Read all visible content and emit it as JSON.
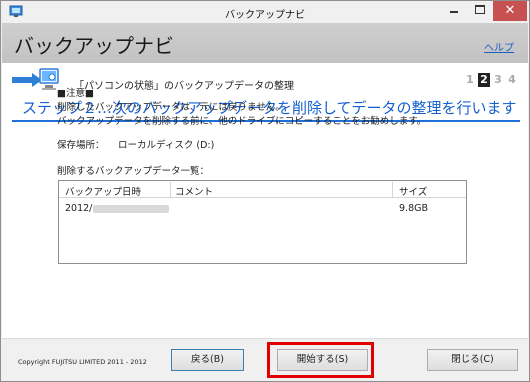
{
  "window": {
    "title": "バックアップナビ",
    "controls": {
      "minimize": "minimize",
      "maximize": "maximize",
      "close": "✕"
    }
  },
  "header": {
    "title": "バックアップナビ",
    "help_link": "ヘルプ"
  },
  "step": {
    "caption": "「パソコンの状態」のバックアップデータの整理",
    "numbers": [
      "1",
      "2",
      "3",
      "4"
    ],
    "active_index": 1,
    "heading": "ステップ２…次のバックアップデータを削除してデータの整理を行います"
  },
  "notice": {
    "title": "■注意■",
    "line1": "削除したバックアップデータは、元には戻りません。",
    "line2": "バックアップデータを削除する前に、他のドライブにコピーすることをお勧めします。"
  },
  "storage": {
    "label": "保存場所：",
    "value": "ローカルディスク (D:)"
  },
  "list": {
    "label": "削除するバックアップデータ一覧：",
    "columns": [
      "バックアップ日時",
      "コメント",
      "サイズ"
    ],
    "rows": [
      {
        "date": "2012/",
        "comment": "",
        "size": "9.8GB"
      }
    ]
  },
  "footer": {
    "copyright": "Copyright FUJITSU LIMITED 2011 - 2012",
    "back_button": "戻る(B)",
    "start_button": "開始する(S)",
    "close_button": "閉じる(C)"
  },
  "colors": {
    "accent_blue": "#1560d0",
    "highlight_red": "#e00000"
  }
}
